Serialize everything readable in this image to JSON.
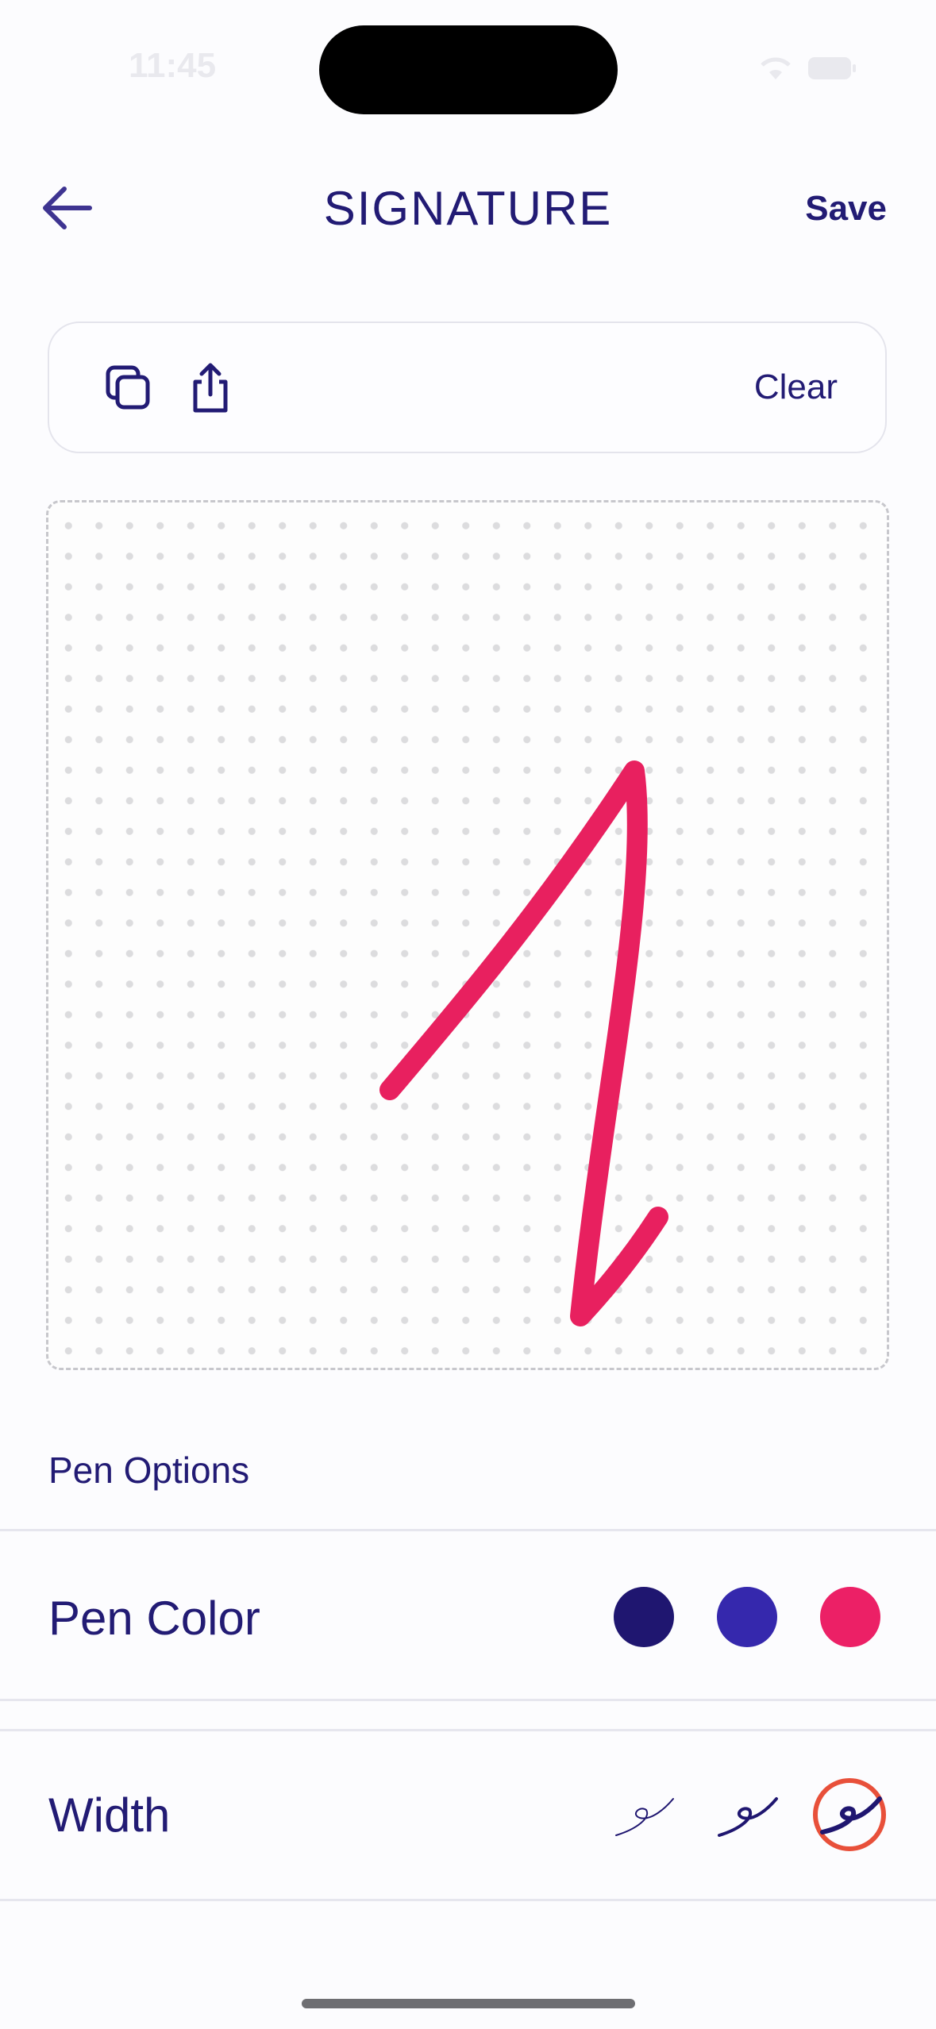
{
  "status_bar": {
    "time": "11:45"
  },
  "header": {
    "title": "SIGNATURE",
    "save_label": "Save",
    "back_icon": "arrow-left-icon"
  },
  "toolbar": {
    "copy_icon": "copy-icon",
    "share_icon": "share-icon",
    "clear_label": "Clear"
  },
  "canvas": {
    "stroke_color": "#e8205f",
    "background": "dotted-grid"
  },
  "pen_options": {
    "section_label": "Pen Options",
    "color_label": "Pen Color",
    "colors": [
      "#1f1670",
      "#3528ad",
      "#ec2066"
    ],
    "selected_color": "#ec2066",
    "width_label": "Width",
    "widths": [
      "thin",
      "medium",
      "thick"
    ],
    "selected_width": "thick",
    "selection_ring_color": "#e8503a"
  },
  "colors": {
    "primary_text": "#221b74",
    "accent": "#ec2066"
  }
}
